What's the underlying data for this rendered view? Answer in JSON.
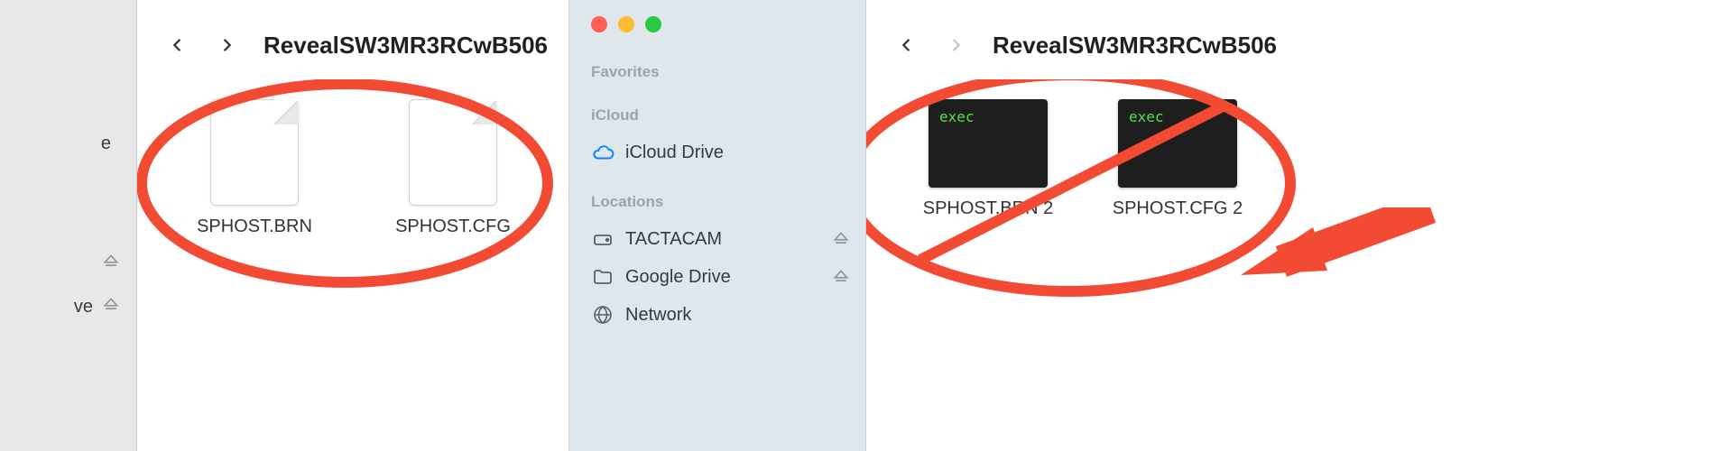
{
  "left_partial_sidebar": {
    "items": [
      {
        "label": "e"
      },
      {
        "label": ""
      },
      {
        "label": "ve"
      }
    ]
  },
  "window_left": {
    "title": "RevealSW3MR3RCwB506",
    "files": [
      {
        "name": "SPHOST.BRN"
      },
      {
        "name": "SPHOST.CFG"
      }
    ]
  },
  "mid_sidebar": {
    "sections": {
      "favorites_header": "Favorites",
      "icloud_header": "iCloud",
      "icloud_items": [
        {
          "label": "iCloud Drive"
        }
      ],
      "locations_header": "Locations",
      "location_items": [
        {
          "label": "TACTACAM",
          "ejectable": true
        },
        {
          "label": "Google Drive",
          "ejectable": true
        },
        {
          "label": "Network",
          "ejectable": false
        }
      ]
    }
  },
  "window_right": {
    "title": "RevealSW3MR3RCwB506",
    "files": [
      {
        "name": "SPHOST.BRN 2",
        "exec_label": "exec"
      },
      {
        "name": "SPHOST.CFG 2",
        "exec_label": "exec"
      }
    ]
  },
  "annotation_color": "#f24a33"
}
